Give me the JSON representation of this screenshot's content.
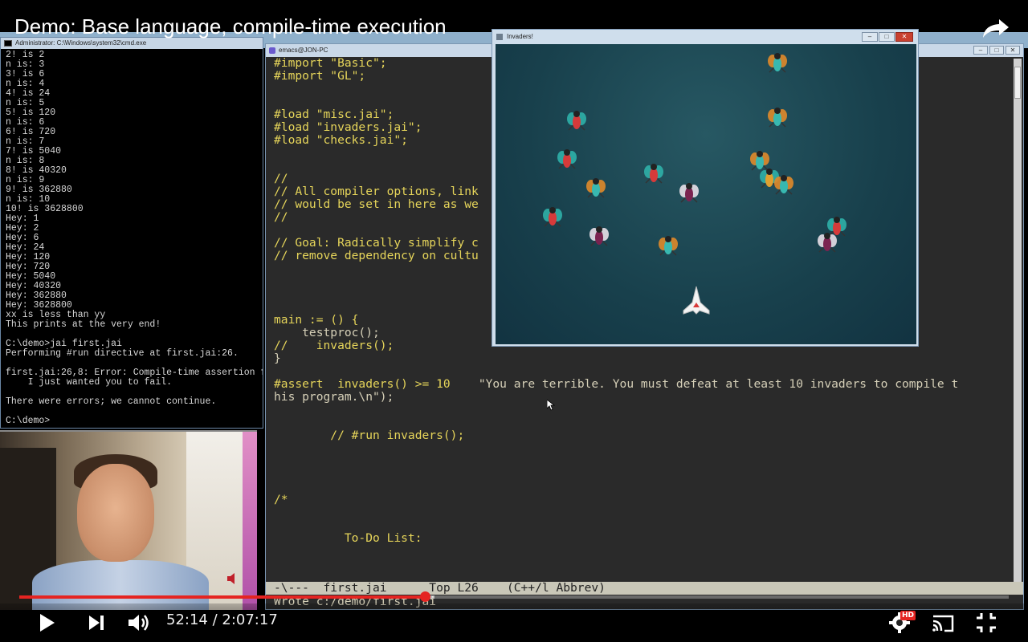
{
  "video": {
    "title": "Demo: Base language, compile-time execution",
    "time_current": "52:14",
    "time_total": "2:07:17",
    "time_display": "52:14 / 2:07:17",
    "progress_fraction": 0.41,
    "buffer_fraction": 0.42,
    "hd_label": "HD"
  },
  "cmd": {
    "title": "Administrator: C:\\Windows\\system32\\cmd.exe",
    "lines": [
      "2! is 2",
      "n is: 3",
      "3! is 6",
      "n is: 4",
      "4! is 24",
      "n is: 5",
      "5! is 120",
      "n is: 6",
      "6! is 720",
      "n is: 7",
      "7! is 5040",
      "n is: 8",
      "8! is 40320",
      "n is: 9",
      "9! is 362880",
      "n is: 10",
      "10! is 3628800",
      "Hey: 1",
      "Hey: 2",
      "Hey: 6",
      "Hey: 24",
      "Hey: 120",
      "Hey: 720",
      "Hey: 5040",
      "Hey: 40320",
      "Hey: 362880",
      "Hey: 3628800",
      "xx is less than yy",
      "This prints at the very end!",
      "",
      "C:\\demo>jai first.jai",
      "Performing #run directive at first.jai:26.",
      "",
      "first.jai:26,8: Error: Compile-time assertion fa",
      "    I just wanted you to fail.",
      "",
      "There were errors; we cannot continue.",
      "",
      "C:\\demo>"
    ]
  },
  "emacs": {
    "title": "emacs@JON-PC",
    "code": [
      {
        "t": "#import \"Basic\";",
        "c": "kw"
      },
      {
        "t": "#import \"GL\";",
        "c": "kw"
      },
      {
        "t": "",
        "c": ""
      },
      {
        "t": "",
        "c": ""
      },
      {
        "t": "#load \"misc.jai\";",
        "c": "kw"
      },
      {
        "t": "#load \"invaders.jai\";",
        "c": "kw"
      },
      {
        "t": "#load \"checks.jai\";",
        "c": "kw"
      },
      {
        "t": "",
        "c": ""
      },
      {
        "t": "",
        "c": ""
      },
      {
        "t": "//",
        "c": "cm"
      },
      {
        "t": "// All compiler options, link",
        "c": "cm"
      },
      {
        "t": "// would be set in here as we",
        "c": "cm"
      },
      {
        "t": "//",
        "c": "cm"
      },
      {
        "t": "",
        "c": ""
      },
      {
        "t": "// Goal: Radically simplify c",
        "c": "cm"
      },
      {
        "t": "// remove dependency on cultu",
        "c": "cm"
      },
      {
        "t": "",
        "c": ""
      },
      {
        "t": "",
        "c": ""
      },
      {
        "t": "",
        "c": ""
      },
      {
        "t": "",
        "c": ""
      },
      {
        "t": "main := () {",
        "c": "kw"
      },
      {
        "t": "    testproc();",
        "c": "str"
      },
      {
        "t": "//    invaders();",
        "c": "cm"
      },
      {
        "t": "}",
        "c": "str"
      },
      {
        "t": "",
        "c": ""
      },
      {
        "t": "#assert  invaders() >= 10    \"You are terrible. You must defeat at least 10 invaders to compile t",
        "c": "mixed"
      },
      {
        "t": "his program.\\n\");",
        "c": "str"
      },
      {
        "t": "",
        "c": ""
      },
      {
        "t": "",
        "c": ""
      },
      {
        "t": "        // #run invaders();",
        "c": "cm"
      },
      {
        "t": "",
        "c": ""
      },
      {
        "t": "",
        "c": ""
      },
      {
        "t": "",
        "c": ""
      },
      {
        "t": "",
        "c": ""
      },
      {
        "t": "/*",
        "c": "cm"
      },
      {
        "t": "",
        "c": ""
      },
      {
        "t": "",
        "c": ""
      },
      {
        "t": "          To-Do List:",
        "c": "cm"
      }
    ],
    "modeline": "-\\---  first.jai      Top L26    (C++/l Abbrev)",
    "minibuffer": "Wrote c:/demo/first.jai"
  },
  "game": {
    "title": "Invaders!",
    "colors": {
      "bg": "#1c4652",
      "bug_red": "#d83a3a",
      "bug_teal": "#2fb0a8",
      "bug_orange": "#e08a2a"
    }
  }
}
